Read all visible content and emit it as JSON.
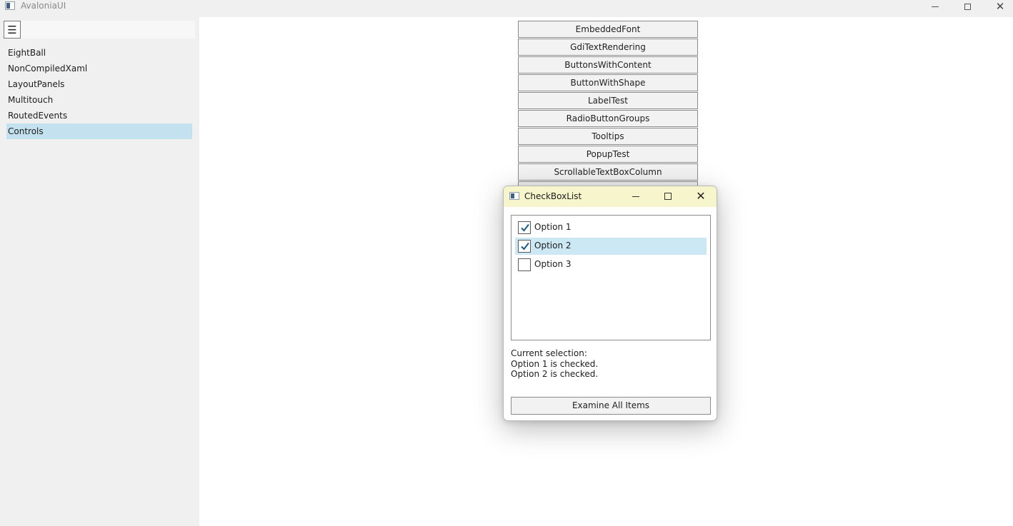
{
  "window": {
    "title": "AvaloniaUI",
    "icon": "app-window-icon"
  },
  "sidebar": {
    "menu_icon": "☰",
    "items": [
      {
        "label": "EightBall",
        "selected": false
      },
      {
        "label": "NonCompiledXaml",
        "selected": false
      },
      {
        "label": "LayoutPanels",
        "selected": false
      },
      {
        "label": "Multitouch",
        "selected": false
      },
      {
        "label": "RoutedEvents",
        "selected": false
      },
      {
        "label": "Controls",
        "selected": true
      }
    ]
  },
  "main": {
    "buttons": [
      "EmbeddedFont",
      "GdiTextRendering",
      "ButtonsWithContent",
      "ButtonWithShape",
      "LabelTest",
      "RadioButtonGroups",
      "Tooltips",
      "PopupTest",
      "ScrollableTextBoxColumn"
    ]
  },
  "dialog": {
    "title": "CheckBoxList",
    "options": [
      {
        "label": "Option 1",
        "checked": true,
        "highlighted": false
      },
      {
        "label": "Option 2",
        "checked": true,
        "highlighted": true
      },
      {
        "label": "Option 3",
        "checked": false,
        "highlighted": false
      }
    ],
    "selection_header": "Current selection:",
    "selection_lines": [
      "Option 1 is checked.",
      "Option 2 is checked."
    ],
    "examine_label": "Examine All Items"
  },
  "colors": {
    "selected_nav": "#c3e1ee",
    "dialog_titlebar": "#f7f5cc",
    "highlight_row": "#cce8f4",
    "check_color": "#1a5a8a"
  }
}
